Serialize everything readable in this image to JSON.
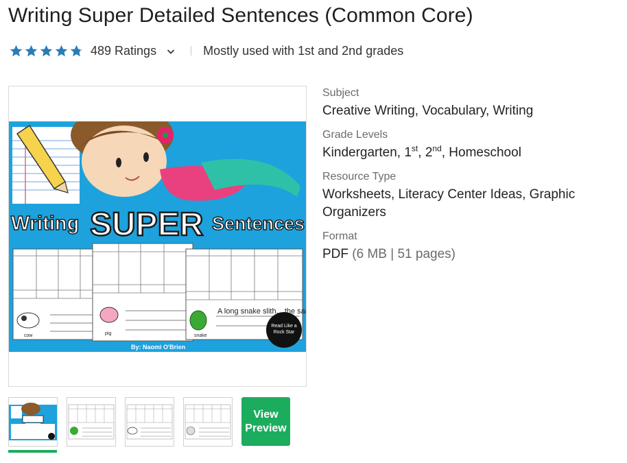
{
  "product": {
    "title": "Writing Super Detailed Sentences (Common Core)",
    "rating_stars": 4.8,
    "ratings_count_label": "489 Ratings",
    "grades_note": "Mostly used with 1st and 2nd grades"
  },
  "image": {
    "headline_left": "Writing",
    "headline_mid": "SUPER",
    "headline_right": "Sentences",
    "byline": "By: Naomi O'Brien",
    "badge_line1": "Read Like a",
    "badge_line2": "Rock Star",
    "label_cow": "cow",
    "label_pig": "pig",
    "label_snake": "snake",
    "sentence_snake": "A long snake slith... the sand last nig..."
  },
  "thumbnails": [
    {
      "name": "thumb-1",
      "active": true
    },
    {
      "name": "thumb-2",
      "active": false
    },
    {
      "name": "thumb-3",
      "active": false
    },
    {
      "name": "thumb-4",
      "active": false
    }
  ],
  "view_preview": {
    "line1": "View",
    "line2": "Preview"
  },
  "details": {
    "subject_label": "Subject",
    "subject_value": "Creative Writing, Vocabulary, Writing",
    "grade_label": "Grade Levels",
    "grade_k": "Kindergarten, 1",
    "grade_sup1": "st",
    "grade_mid": ", 2",
    "grade_sup2": "nd",
    "grade_tail": ", Homeschool",
    "resource_label": "Resource Type",
    "resource_line1": "Worksheets, Literacy Center Ideas, Graphic",
    "resource_line2": "Organizers",
    "format_label": "Format",
    "format_type": "PDF",
    "format_size": "(6 MB",
    "format_sep": "|",
    "format_pages": "51 pages)"
  },
  "colors": {
    "star": "#2a7cb8",
    "accent": "#1cac5e",
    "cover_blue": "#1da2dd"
  }
}
